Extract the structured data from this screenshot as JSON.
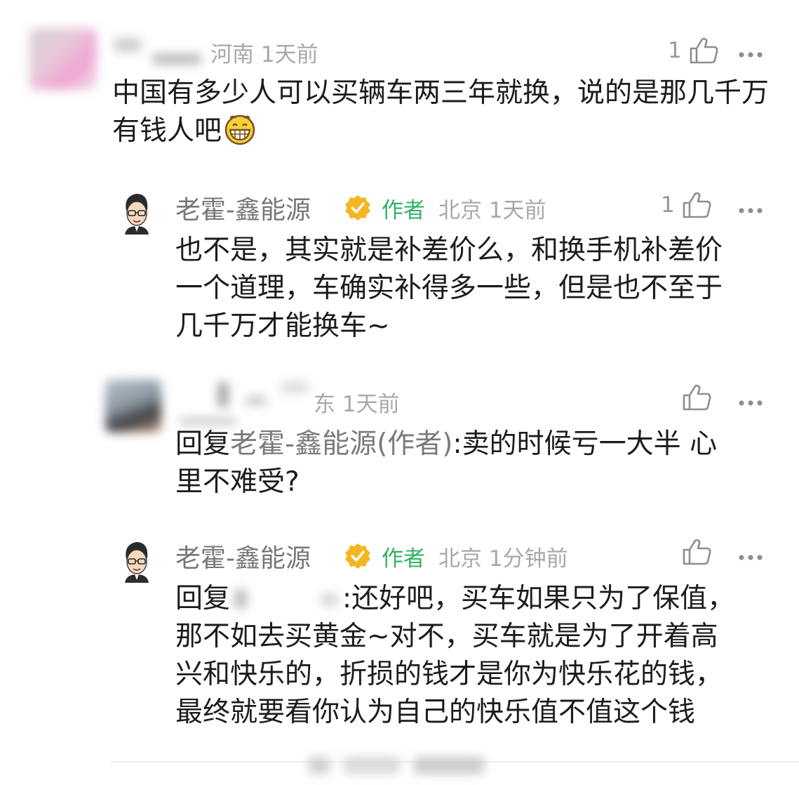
{
  "comments": [
    {
      "location_time": "河南 1天前",
      "likes": "1",
      "text": "中国有多少人可以买辆车两三年就换，说的是那几千万有钱人吧"
    }
  ],
  "replies": [
    {
      "name": "老霍-鑫能源",
      "author_tag": "作者",
      "location_time": "北京 1天前",
      "likes": "1",
      "text_lines": [
        "也不是，其实就是补差价么，和换手机补差价",
        "一个道理，车确实补得多一些，但是也不至于",
        "几千万才能换车~"
      ]
    },
    {
      "location_time": "东 1天前",
      "reply_prefix": "回复",
      "reply_target": "老霍-鑫能源(作者)",
      "text_first": ":卖的时候亏一大半 心",
      "text_second": "里不难受?"
    },
    {
      "name": "老霍-鑫能源",
      "author_tag": "作者",
      "location_time": "北京 1分钟前",
      "reply_prefix": "回复",
      "text_lines": [
        ":还好吧，买车如果只为了保值，",
        "那不如去买黄金~对不，买车就是为了开着高",
        "兴和快乐的，折损的钱才是你为快乐花的钱，",
        "最终就要看你认为自己的快乐值不值这个钱"
      ]
    }
  ],
  "icons": {
    "like": "thumbs-up-icon",
    "more": "more-dots-icon",
    "verified": "verified-badge-icon",
    "emoji": "grinning-emoji-icon"
  },
  "colors": {
    "author_green": "#33b265",
    "badge_gold": "#f5b520",
    "meta_gray": "#a8a8a8"
  }
}
